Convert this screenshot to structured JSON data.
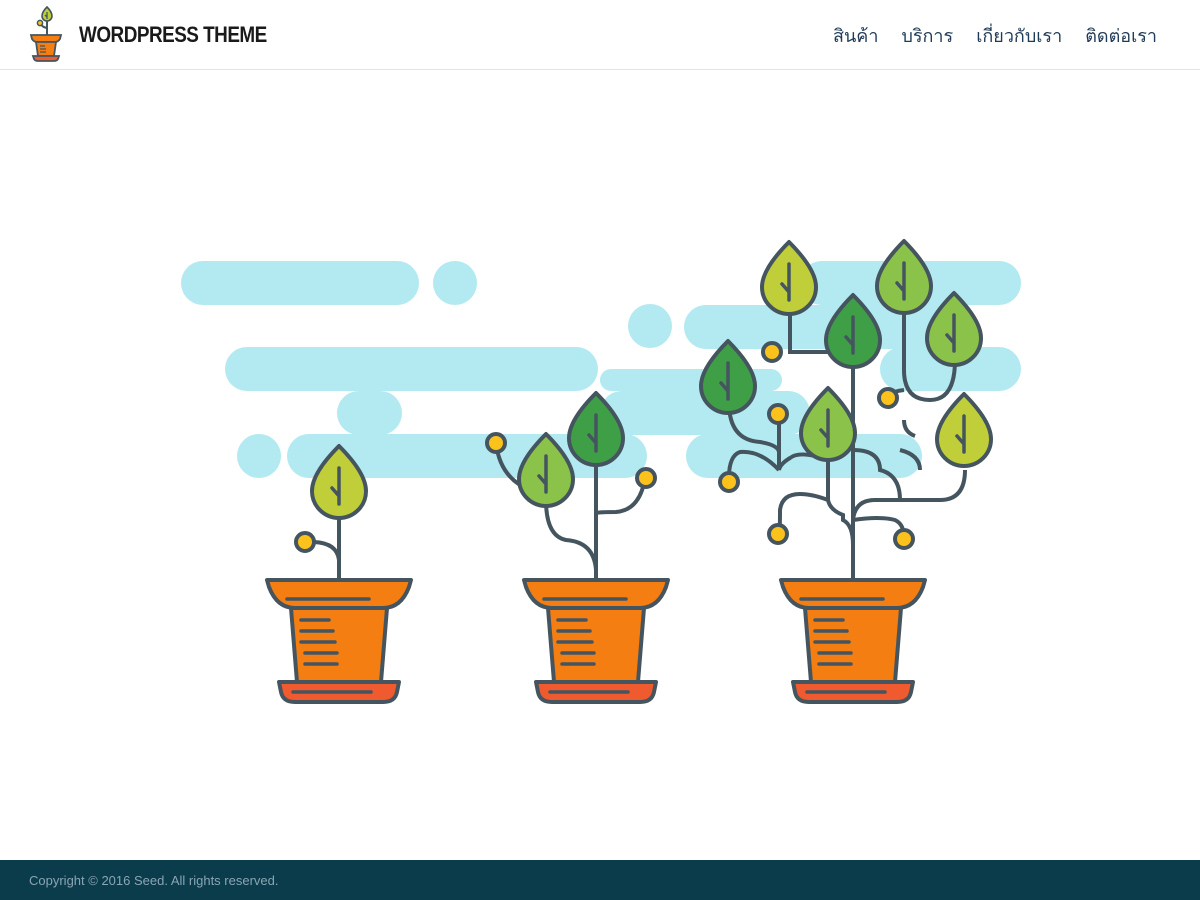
{
  "header": {
    "site_title": "WORDPRESS THEME",
    "logo_icon": "potted-sprout-icon",
    "nav": [
      {
        "label": "สินค้า"
      },
      {
        "label": "บริการ"
      },
      {
        "label": "เกี่ยวกับเรา"
      },
      {
        "label": "ติดต่อเรา"
      }
    ]
  },
  "hero": {
    "illustration": "three-growing-plants-illustration",
    "colors": {
      "cloud": "#b3e9f1",
      "pot": "#f57e12",
      "saucer": "#ef5a2e",
      "outline": "#45555f",
      "leaf_lime": "#c0ce3a",
      "leaf_light": "#8bc34a",
      "leaf_dark": "#3f9f47",
      "bud": "#fbc21c"
    }
  },
  "footer": {
    "copyright": "Copyright © 2016 Seed. All rights reserved.",
    "background": "#0b3c4c"
  }
}
